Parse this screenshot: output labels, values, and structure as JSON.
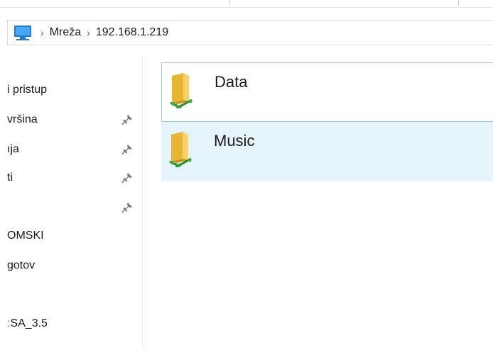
{
  "address_bar": {
    "icon": "network-computer-icon",
    "breadcrumbs": [
      "Mreža",
      "192.168.1.219"
    ]
  },
  "navigation": {
    "items": [
      {
        "label": "i pristup",
        "pinned": false
      },
      {
        "label": "vršina",
        "pinned": true
      },
      {
        "label": "ıja",
        "pinned": true
      },
      {
        "label": "ti",
        "pinned": true
      },
      {
        "label": "",
        "pinned": true
      },
      {
        "label": "OMSKI",
        "pinned": false
      },
      {
        "label": "gotov",
        "pinned": false
      },
      {
        "label": "",
        "pinned": false
      },
      {
        "label": "ːSA_3.5",
        "pinned": false
      }
    ]
  },
  "content": {
    "items": [
      {
        "name": "Data",
        "icon": "network-share-folder-icon",
        "state": "focused"
      },
      {
        "name": "Music",
        "icon": "network-share-folder-icon",
        "state": "selected"
      }
    ]
  },
  "colors": {
    "selection_background": "#e5f3fb",
    "focus_border": "#99c9ef",
    "accent": "#1e7fd1"
  }
}
